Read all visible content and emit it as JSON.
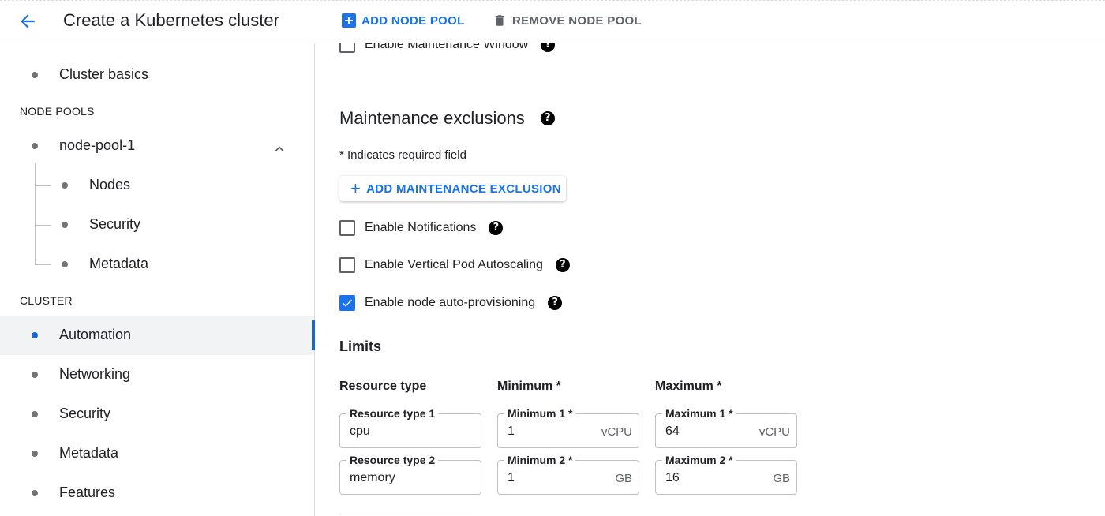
{
  "header": {
    "title": "Create a Kubernetes cluster",
    "add_node_pool": "ADD NODE POOL",
    "remove_node_pool": "REMOVE NODE POOL"
  },
  "sidebar": {
    "cluster_basics": "Cluster basics",
    "node_pools_header": "NODE POOLS",
    "node_pool_name": "node-pool-1",
    "node_pool_items": [
      "Nodes",
      "Security",
      "Metadata"
    ],
    "cluster_header": "CLUSTER",
    "cluster_items": [
      "Automation",
      "Networking",
      "Security",
      "Metadata",
      "Features"
    ],
    "active_item": "Automation"
  },
  "main": {
    "maintenance_window_label": "Enable Maintenance Window",
    "exclusions_title": "Maintenance exclusions",
    "required_note": "* Indicates required field",
    "add_exclusion": "ADD MAINTENANCE EXCLUSION",
    "checkboxes": [
      {
        "label": "Enable Notifications",
        "checked": false
      },
      {
        "label": "Enable Vertical Pod Autoscaling",
        "checked": false
      },
      {
        "label": "Enable node auto-provisioning",
        "checked": true
      }
    ],
    "limits_title": "Limits",
    "columns": [
      "Resource type",
      "Minimum *",
      "Maximum *"
    ],
    "rows": [
      {
        "resource_label": "Resource type 1",
        "resource_value": "cpu",
        "min_label": "Minimum 1 *",
        "min_value": "1",
        "min_unit": "vCPU",
        "max_label": "Maximum 1 *",
        "max_value": "64",
        "max_unit": "vCPU"
      },
      {
        "resource_label": "Resource type 2",
        "resource_value": "memory",
        "min_label": "Minimum 2 *",
        "min_value": "1",
        "min_unit": "GB",
        "max_label": "Maximum 2 *",
        "max_value": "16",
        "max_unit": "GB"
      }
    ]
  },
  "colors": {
    "accent": "#1a73e8",
    "active_nav": "#1967d2",
    "text": "#202124",
    "muted": "#5f6368"
  }
}
